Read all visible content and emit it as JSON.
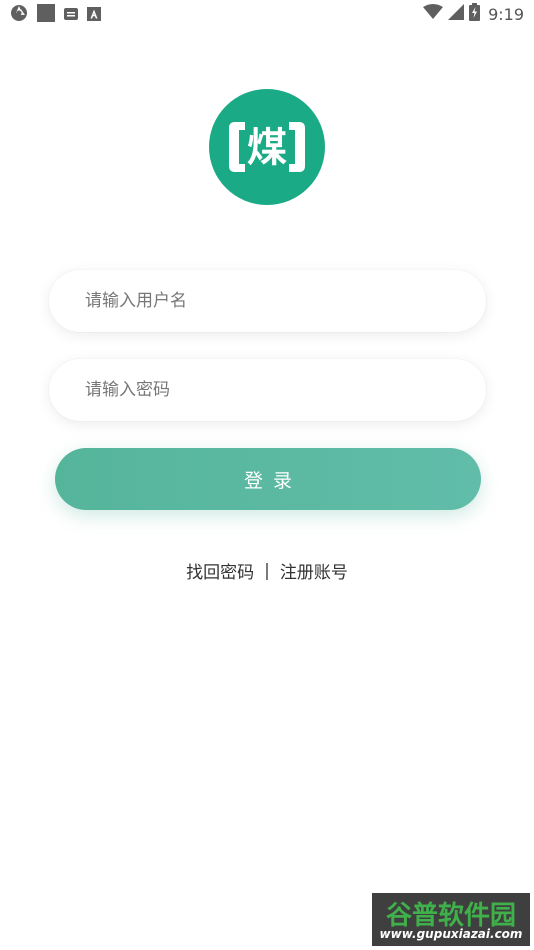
{
  "status_bar": {
    "time": "9:19",
    "left_icons": [
      "aperture-icon",
      "square-icon",
      "notification-icon",
      "font-a-icon"
    ],
    "right_icons": [
      "wifi-icon",
      "signal-icon",
      "battery-icon"
    ]
  },
  "logo": {
    "glyph": "煤",
    "accent_color": "#1aaa85"
  },
  "form": {
    "username_placeholder": "请输入用户名",
    "password_placeholder": "请输入密码",
    "login_label": "登录"
  },
  "links": {
    "forgot_password": "找回密码",
    "separator": "|",
    "register": "注册账号"
  },
  "watermark": {
    "title": "谷普软件园",
    "url": "www.gupuxiazai.com"
  },
  "colors": {
    "accent": "#55b59b",
    "background": "#ffffff"
  }
}
